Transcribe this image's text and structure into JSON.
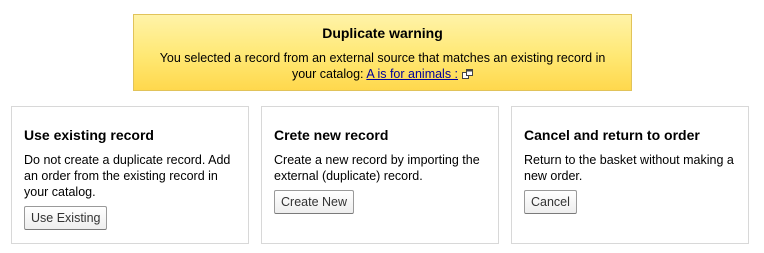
{
  "warning": {
    "title": "Duplicate warning",
    "message": "You selected a record from an external source that matches an existing record in your catalog:",
    "record_link": "A is for animals :",
    "link_icon": "external-link-icon"
  },
  "options": [
    {
      "title": "Use existing record",
      "description": "Do not create a duplicate record. Add an order from the existing record in your catalog.",
      "button": "Use Existing"
    },
    {
      "title": "Crete new record",
      "description": "Create a new record by importing the external (duplicate) record.",
      "button": "Create New"
    },
    {
      "title": "Cancel and return to order",
      "description": "Return to the basket without making a new order.",
      "button": "Cancel"
    }
  ],
  "colors": {
    "warning_background": "#ffe873",
    "warning_border": "#e1c35a",
    "link": "#000099",
    "card_border": "#d8d8d8"
  }
}
